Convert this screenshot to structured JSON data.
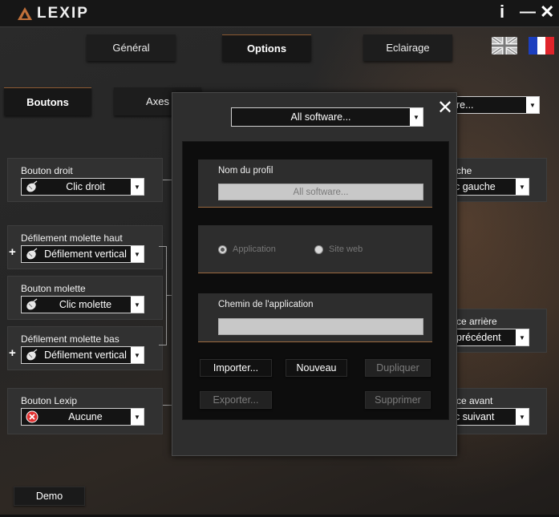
{
  "app": {
    "name": "LEXIP",
    "accent": "#c0703a"
  },
  "titlebar": {
    "info_glyph": "i",
    "minimize_glyph": "—",
    "close_glyph": "✕"
  },
  "main_tabs": [
    {
      "label": "Général"
    },
    {
      "label": "Options"
    },
    {
      "label": "Eclairage"
    }
  ],
  "languages": [
    {
      "name": "uk-flag-icon"
    },
    {
      "name": "fr-flag-icon"
    }
  ],
  "sub_tabs": [
    {
      "label": "Boutons"
    },
    {
      "label": "Axes"
    }
  ],
  "left_panels": [
    {
      "label": "Bouton droit",
      "value": "Clic droit",
      "icon": "mouse-icon"
    },
    {
      "label": "Défilement molette haut",
      "value": "Défilement vertical",
      "icon": "mouse-icon",
      "plus": "+"
    },
    {
      "label": "Bouton molette",
      "value": "Clic molette",
      "icon": "mouse-icon"
    },
    {
      "label": "Défilement molette bas",
      "value": "Défilement vertical",
      "icon": "mouse-icon",
      "plus": "+"
    },
    {
      "label": "Bouton Lexip",
      "value": "Aucune",
      "icon": "error-icon"
    }
  ],
  "right_panels": [
    {
      "label": "che",
      "value": "c gauche"
    },
    {
      "label": "ce arrière",
      "value": "précédent"
    },
    {
      "label": "ce avant",
      "value": "c suivant"
    }
  ],
  "right_top_combo": {
    "value": "re..."
  },
  "demo_button": {
    "label": "Demo"
  },
  "modal": {
    "close_glyph": "✕",
    "software_select": "All software...",
    "profile_name_label": "Nom du profil",
    "profile_name_value": "All software...",
    "radio_application": "Application",
    "radio_website": "Site web",
    "app_path_label": "Chemin de l'application",
    "app_path_value": "",
    "buttons": {
      "import": "Importer...",
      "new": "Nouveau",
      "duplicate": "Dupliquer",
      "export": "Exporter...",
      "delete": "Supprimer"
    }
  }
}
